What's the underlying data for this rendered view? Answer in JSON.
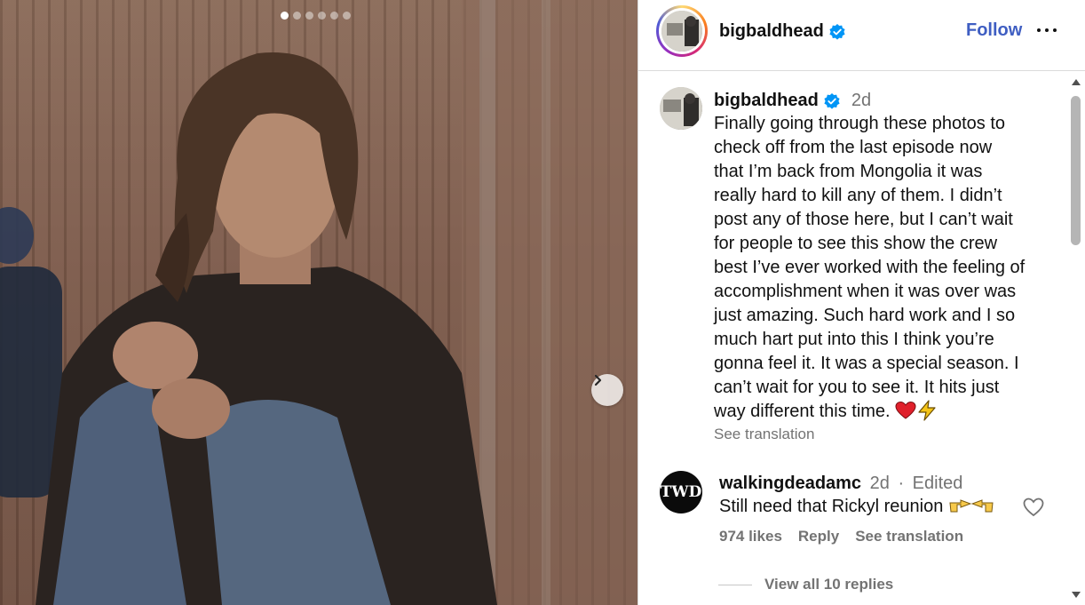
{
  "post": {
    "username": "bigbaldhead",
    "follow_label": "Follow",
    "more_icon": "more-options-icon",
    "carousel": {
      "slide_count": 6,
      "active_index": 0
    }
  },
  "caption": {
    "username": "bigbaldhead",
    "time": "2d",
    "text": "Finally going through these photos to\ncheck off from the last episode now\nthat I’m back from Mongolia it was\nreally hard to kill any of them. I didn’t\npost any of those here, but I can’t wait\nfor people to see this show the crew\nbest I’ve ever worked with the feeling of\naccomplishment when it was over was\njust amazing. Such hard work and I so\nmuch hart put into this I think you’re\ngonna feel it. It was a special season. I\ncan’t wait for you to see it. It hits just\nway different this time.",
    "see_translation": "See translation"
  },
  "comment": {
    "avatar_text": "TWD",
    "username": "walkingdeadamc",
    "time": "2d",
    "separator": "·",
    "edited": "Edited",
    "text": "Still need that Rickyl reunion",
    "likes": "974 likes",
    "reply": "Reply",
    "see_translation": "See translation",
    "view_replies": "View all 10 replies"
  },
  "colors": {
    "follow": "#3f5ec2",
    "verified": "#0095f6",
    "muted": "#737373",
    "heart_emoji": "#e0202b",
    "bolt_emoji": "#f5c518"
  }
}
